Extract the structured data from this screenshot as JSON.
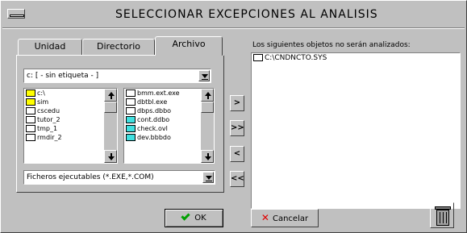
{
  "window": {
    "title": "SELECCIONAR EXCEPCIONES AL ANALISIS"
  },
  "tabs": [
    {
      "label": "Unidad"
    },
    {
      "label": "Directorio"
    },
    {
      "label": "Archivo"
    }
  ],
  "drive_combo": {
    "value": "c: [ - sin etiqueta - ]"
  },
  "dir_list": [
    {
      "name": "c:\\",
      "icon": "folder-open-icon"
    },
    {
      "name": "sim",
      "icon": "folder-open-icon"
    },
    {
      "name": "cscedu",
      "icon": "folder-closed-icon"
    },
    {
      "name": "tutor_2",
      "icon": "folder-closed-icon"
    },
    {
      "name": "tmp_1",
      "icon": "folder-closed-icon"
    },
    {
      "name": "rmdir_2",
      "icon": "folder-closed-icon"
    }
  ],
  "file_list": [
    {
      "name": "bmm.ext.exe",
      "icon": "file-icon"
    },
    {
      "name": "dbtbl.exe",
      "icon": "file-icon"
    },
    {
      "name": "dbps.dbbo",
      "icon": "file-icon"
    },
    {
      "name": "cont.ddbo",
      "icon": "file-icon-cyan"
    },
    {
      "name": "check.ovl",
      "icon": "file-icon-cyan"
    },
    {
      "name": "dev.bbbdo",
      "icon": "file-icon-cyan"
    }
  ],
  "filter_combo": {
    "value": "Ficheros ejecutables (*.EXE,*.COM)"
  },
  "move_buttons": [
    ">",
    ">>",
    "<",
    "<<"
  ],
  "right_panel": {
    "label": "Los siguientes objetos no serán analizados:",
    "items": [
      {
        "name": "C:\\CNDNCTO.SYS"
      }
    ]
  },
  "buttons": {
    "ok": "OK",
    "cancel": "Cancelar"
  },
  "colors": {
    "face": "#c0c0c0",
    "folder": "#ffff00",
    "file_cyan": "#40e0e0",
    "ok_check": "#00a000",
    "cancel_x": "#e00000"
  }
}
